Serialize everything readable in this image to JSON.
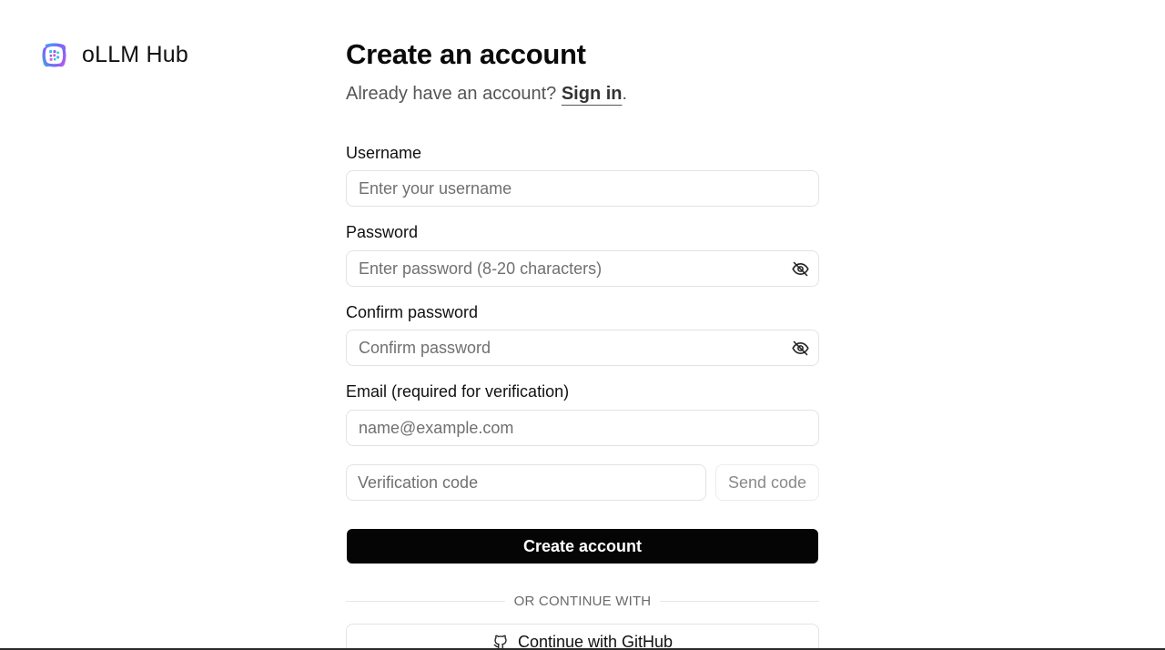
{
  "brand": {
    "name": "oLLM Hub",
    "logo_icon": "ollm-hub-logo-icon",
    "logo_colors": [
      "#2fb7f5",
      "#7b61ff",
      "#d65bd6",
      "#27c6c9"
    ]
  },
  "form": {
    "title": "Create an account",
    "subtitle_prefix": "Already have an account? ",
    "signin_link": "Sign in",
    "subtitle_suffix": ".",
    "username": {
      "label": "Username",
      "placeholder": "Enter your username",
      "value": ""
    },
    "password": {
      "label": "Password",
      "placeholder": "Enter password (8-20 characters)",
      "value": "",
      "toggle_icon": "eye-off-icon"
    },
    "confirm_password": {
      "label": "Confirm password",
      "placeholder": "Confirm password",
      "value": "",
      "toggle_icon": "eye-off-icon"
    },
    "email": {
      "label": "Email (required for verification)",
      "placeholder": "name@example.com",
      "value": ""
    },
    "verification": {
      "placeholder": "Verification code",
      "value": "",
      "send_code_label": "Send code"
    },
    "submit_label": "Create account",
    "divider_text": "OR CONTINUE WITH",
    "github_label": "Continue with GitHub",
    "github_icon": "github-icon"
  },
  "colors": {
    "primary_button": "#050505",
    "primary_button_text": "#ffffff",
    "border": "#e3e3e3",
    "muted_text": "#707070"
  }
}
